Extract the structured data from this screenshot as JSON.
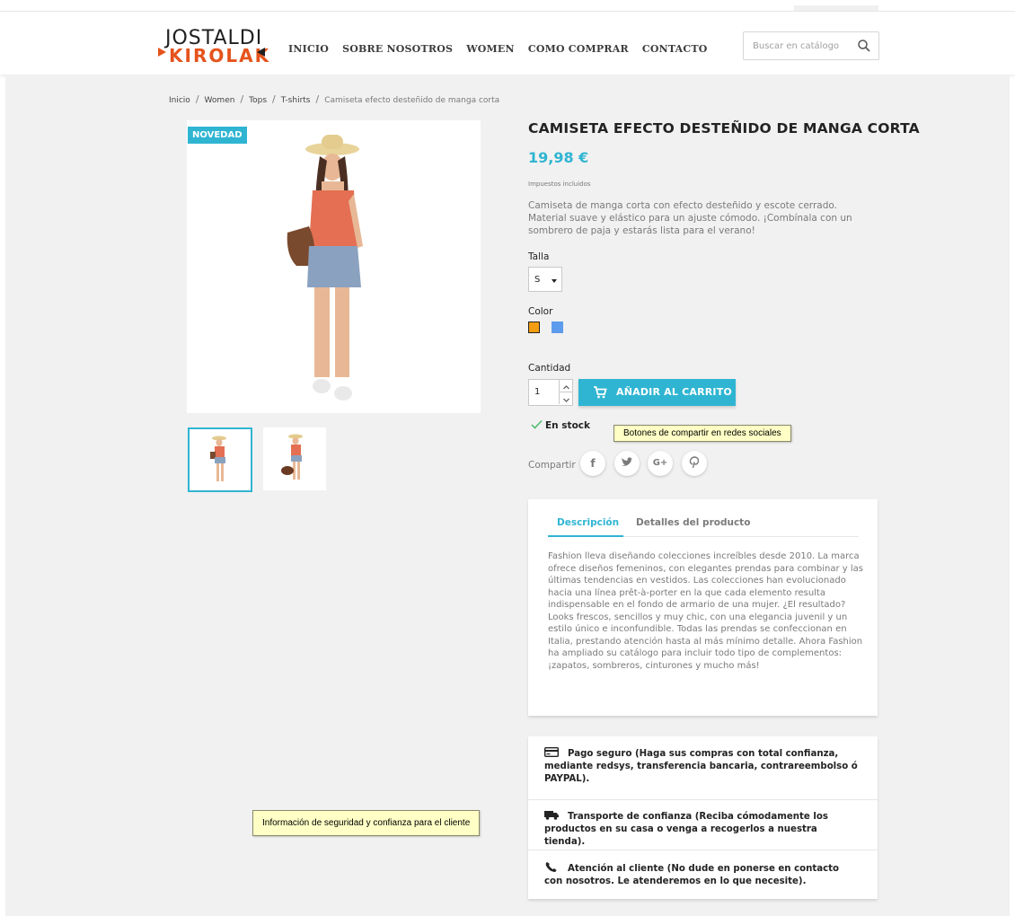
{
  "header": {
    "logo_line1": "JOSTALDI",
    "logo_line2": "KIROLAK",
    "nav": [
      "INICIO",
      "SOBRE NOSOTROS",
      "WOMEN",
      "COMO COMPRAR",
      "CONTACTO"
    ],
    "search_placeholder": "Buscar en catálogo"
  },
  "breadcrumb": [
    "Inicio",
    "Women",
    "Tops",
    "T-shirts",
    "Camiseta efecto desteñido de manga corta"
  ],
  "product": {
    "badge": "NOVEDAD",
    "title": "CAMISETA EFECTO DESTEÑIDO DE MANGA CORTA",
    "price": "19,98 €",
    "tax_note": "Impuestos incluidos",
    "short_desc": "Camiseta de manga corta con efecto desteñido y escote cerrado. Material suave y elástico para un ajuste cómodo. ¡Combínala con un sombrero de paja y estarás lista para el verano!",
    "size_label": "Talla",
    "size_value": "S",
    "color_label": "Color",
    "colors": [
      "#f39d12",
      "#5d9cec"
    ],
    "quantity_label": "Cantidad",
    "quantity_value": "1",
    "add_to_cart": "AÑADIR AL CARRITO",
    "stock": "En stock",
    "share_label": "Compartir",
    "social": [
      "f",
      "t",
      "G+",
      "p"
    ]
  },
  "tooltips": {
    "social": "Botones de compartir en redes sociales",
    "reassurance": "Información de seguridad y confianza para el cliente"
  },
  "tabs": {
    "active": "Descripción",
    "other": "Detalles del producto",
    "text": "Fashion lleva diseñando colecciones increíbles desde 2010. La marca ofrece diseños femeninos, con elegantes prendas para combinar y las últimas tendencias en vestidos. Las colecciones han evolucionado hacia una línea prêt-à-porter en la que cada elemento resulta indispensable en el fondo de armario de una mujer. ¿El resultado? Looks frescos, sencillos y muy chic, con una elegancia juvenil y un estilo único e inconfundible. Todas las prendas se confeccionan en Italia, prestando atención hasta al más mínimo detalle. Ahora Fashion ha ampliado su catálogo para incluir todo tipo de complementos: ¡zapatos, sombreros, cinturones y mucho más!"
  },
  "reassurance": [
    "Pago seguro (Haga sus compras con total confianza, mediante redsys, transferencia bancaria, contrareembolso ó PAYPAL).",
    "Transporte de confianza (Reciba cómodamente los productos en su casa o venga a recogerlos a nuestra tienda).",
    "Atención al cliente (No dude en ponerse en contacto con nosotros. Le atenderemos en lo que necesite)."
  ]
}
